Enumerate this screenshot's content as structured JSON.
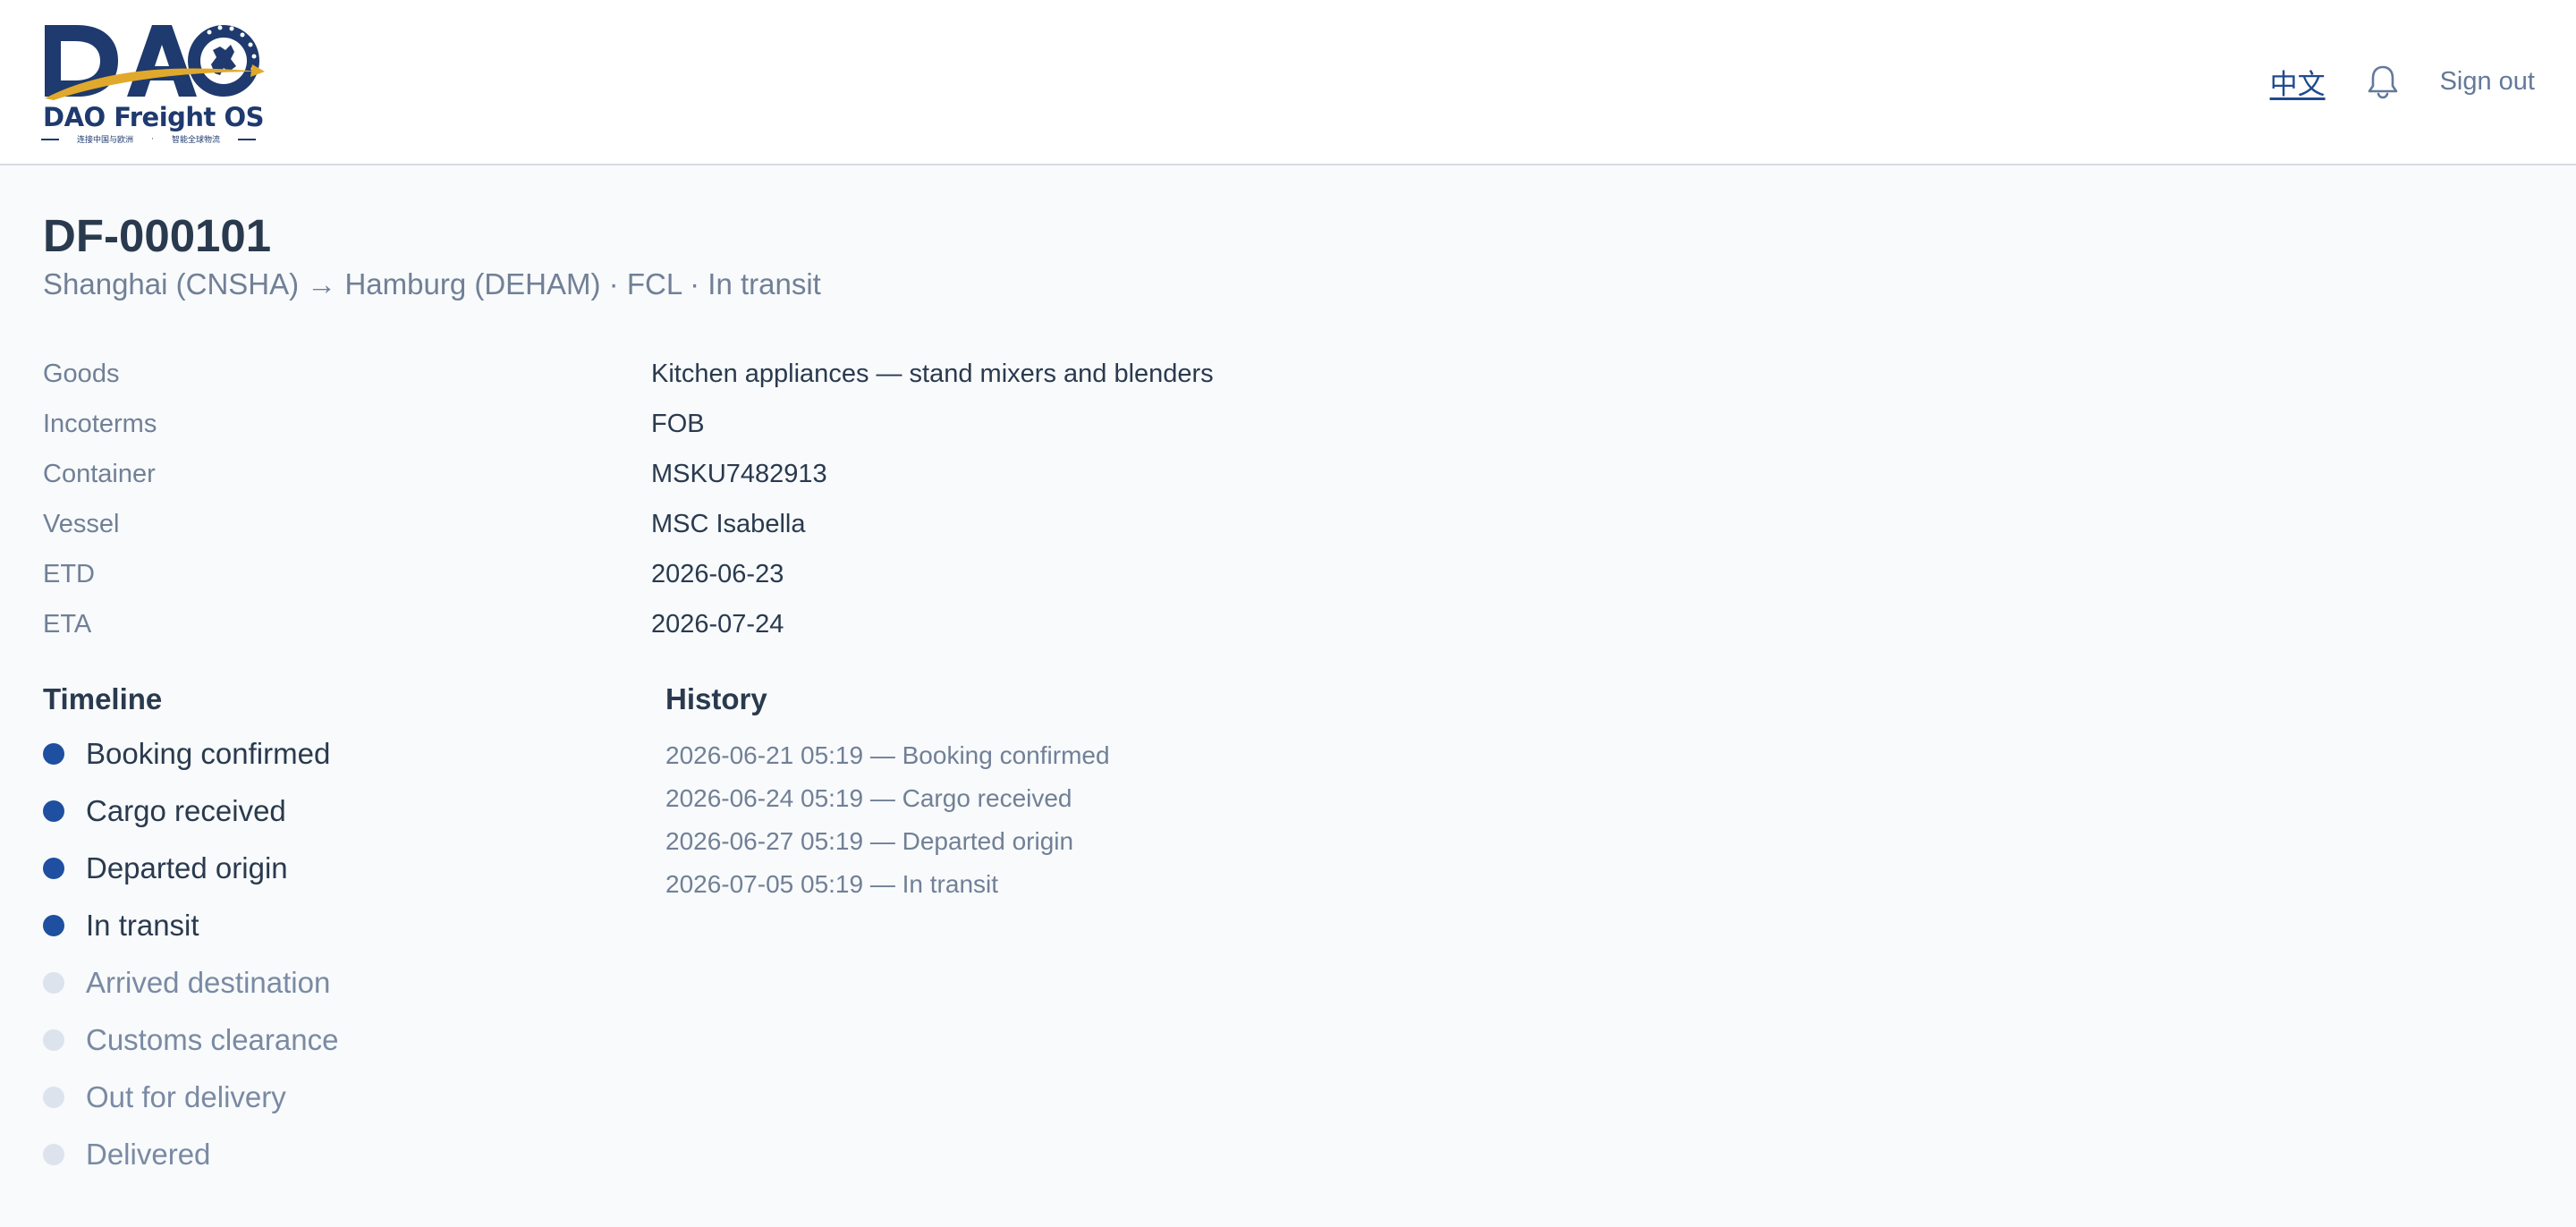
{
  "header": {
    "logo_text": "DAO Freight OS",
    "logo_tagline_left": "连接中国与欧洲",
    "logo_tagline_right": "智能全球物流",
    "logo_tagline_sep": "·",
    "language_link": "中文",
    "bell_icon": "bell-icon",
    "sign_out": "Sign out"
  },
  "shipment": {
    "id": "DF-000101",
    "subtitle": "Shanghai (CNSHA) → Hamburg (DEHAM) · FCL · In transit",
    "details": [
      {
        "label": "Goods",
        "value": "Kitchen appliances — stand mixers and blenders"
      },
      {
        "label": "Incoterms",
        "value": "FOB"
      },
      {
        "label": "Container",
        "value": "MSKU7482913"
      },
      {
        "label": "Vessel",
        "value": "MSC Isabella"
      },
      {
        "label": "ETD",
        "value": "2026-06-23"
      },
      {
        "label": "ETA",
        "value": "2026-07-24"
      }
    ]
  },
  "timeline": {
    "title": "Timeline",
    "steps": [
      {
        "label": "Booking confirmed",
        "state": "done"
      },
      {
        "label": "Cargo received",
        "state": "done"
      },
      {
        "label": "Departed origin",
        "state": "done"
      },
      {
        "label": "In transit",
        "state": "done"
      },
      {
        "label": "Arrived destination",
        "state": "pending"
      },
      {
        "label": "Customs clearance",
        "state": "pending"
      },
      {
        "label": "Out for delivery",
        "state": "pending"
      },
      {
        "label": "Delivered",
        "state": "pending"
      }
    ]
  },
  "history": {
    "title": "History",
    "entries": [
      "2026-06-21 05:19 — Booking confirmed",
      "2026-06-24 05:19 — Cargo received",
      "2026-06-27 05:19 — Departed origin",
      "2026-07-05 05:19 — In transit"
    ]
  },
  "colors": {
    "brand": "#1e3a6e",
    "accent": "#1e4fa0",
    "gold": "#e0a92b",
    "muted": "#718096",
    "pending_dot": "#dde3ec"
  }
}
